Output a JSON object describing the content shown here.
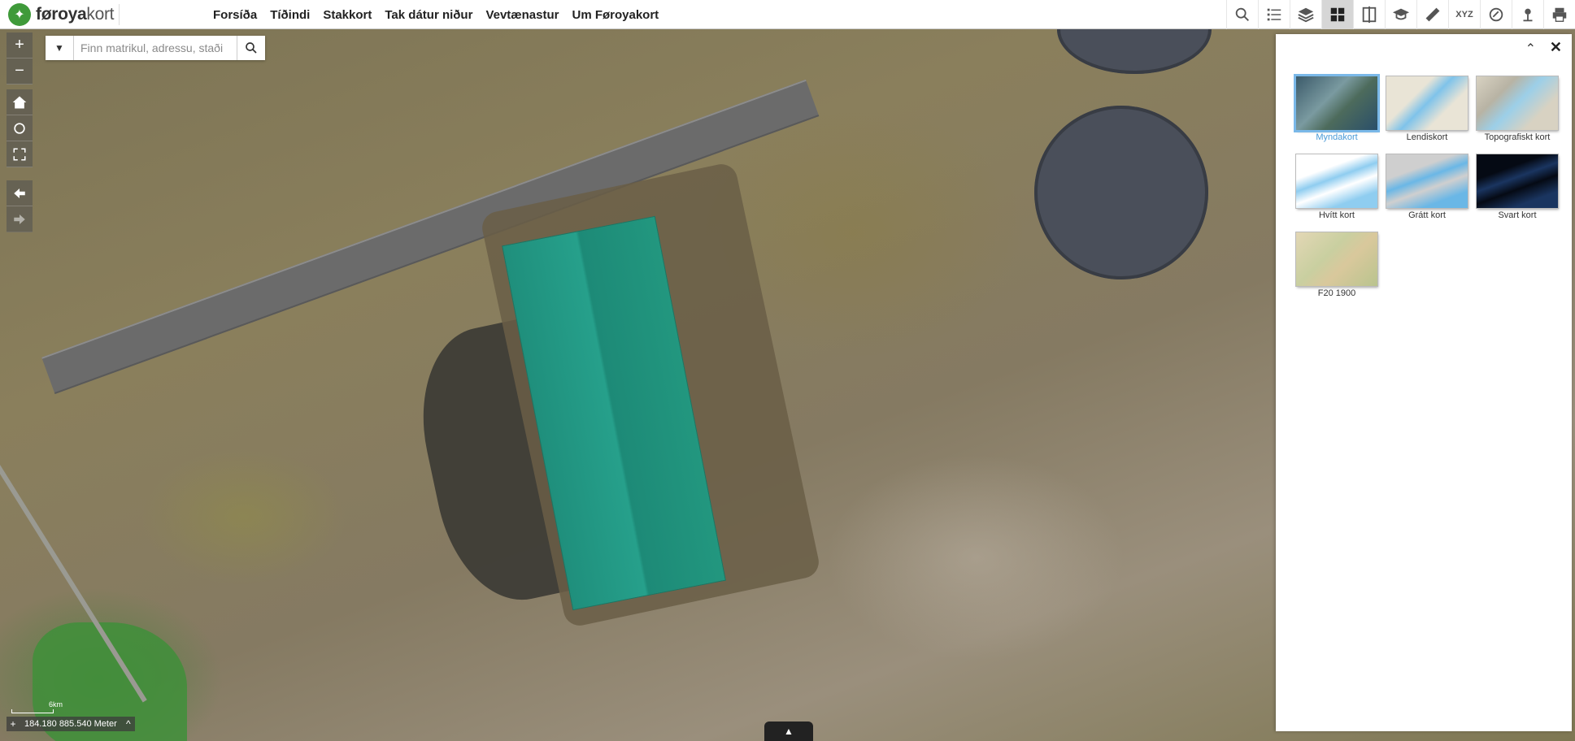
{
  "app": {
    "logo_strong": "føroya",
    "logo_light": "kort"
  },
  "nav": [
    {
      "label": "Forsíða"
    },
    {
      "label": "Tíðindi"
    },
    {
      "label": "Stakkort"
    },
    {
      "label": "Tak dátur niður"
    },
    {
      "label": "Vevtænastur"
    },
    {
      "label": "Um Føroyakort"
    }
  ],
  "toolbar": {
    "icons": [
      "search-list-icon",
      "legend-list-icon",
      "layers-icon",
      "basemap-grid-icon",
      "compare-icon",
      "education-icon",
      "measure-icon",
      "xyz-icon",
      "draw-icon",
      "location-icon",
      "print-icon"
    ],
    "active": "basemap-grid-icon",
    "xyz_label": "XYZ"
  },
  "search": {
    "placeholder": "Finn matrikul, adressu, staði"
  },
  "map_controls": {
    "zoom_in": "+",
    "zoom_out": "−"
  },
  "scale": {
    "text": "184.180 885.540 Meter",
    "bar_label": "6km"
  },
  "basemap_panel": {
    "selected": "Myndakort",
    "items": [
      {
        "label": "Myndakort"
      },
      {
        "label": "Lendiskort"
      },
      {
        "label": "Topografiskt kort"
      },
      {
        "label": "Hvítt kort"
      },
      {
        "label": "Grátt kort"
      },
      {
        "label": "Svart kort"
      },
      {
        "label": "F20 1900"
      }
    ]
  },
  "colors": {
    "brand_green": "#3f9a3a",
    "selected_blue": "#4a9ad6",
    "roof_teal": "#22977f"
  }
}
